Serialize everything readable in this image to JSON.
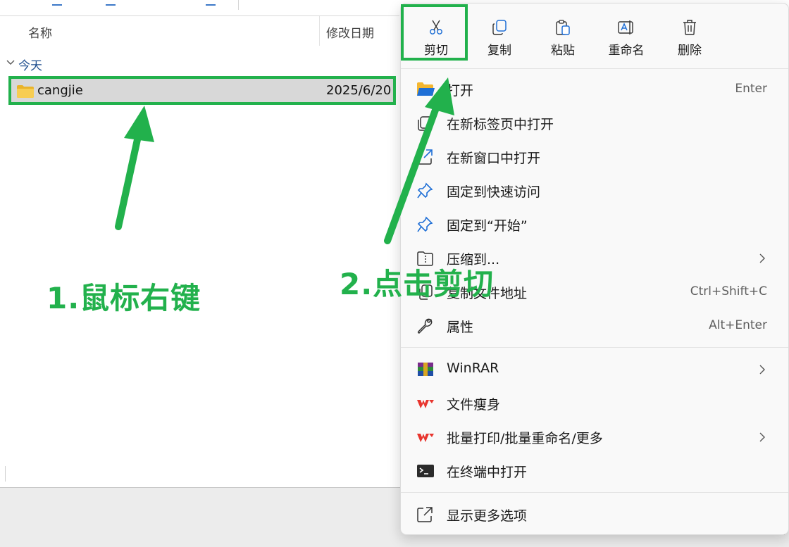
{
  "explorer": {
    "columns": {
      "name": "名称",
      "date": "修改日期"
    },
    "group_label": "今天",
    "rows": [
      {
        "name": "cangjie",
        "date": "2025/6/20"
      }
    ]
  },
  "context_menu": {
    "toolbar": [
      {
        "id": "cut",
        "label": "剪切",
        "icon": "scissors-icon"
      },
      {
        "id": "copy",
        "label": "复制",
        "icon": "copy-icon"
      },
      {
        "id": "paste",
        "label": "粘贴",
        "icon": "paste-icon"
      },
      {
        "id": "rename",
        "label": "重命名",
        "icon": "rename-icon"
      },
      {
        "id": "delete",
        "label": "删除",
        "icon": "trash-icon"
      }
    ],
    "items": [
      {
        "label": "打开",
        "shortcut": "Enter",
        "icon": "folder-open-icon"
      },
      {
        "label": "在新标签页中打开",
        "shortcut": "",
        "icon": "new-tab-icon"
      },
      {
        "label": "在新窗口中打开",
        "shortcut": "",
        "icon": "new-window-icon"
      },
      {
        "label": "固定到快速访问",
        "shortcut": "",
        "icon": "pin-icon"
      },
      {
        "label": "固定到“开始”",
        "shortcut": "",
        "icon": "pin-icon"
      },
      {
        "label": "压缩到...",
        "shortcut": "",
        "icon": "zip-folder-icon",
        "submenu": true
      },
      {
        "label": "复制文件地址",
        "shortcut": "Ctrl+Shift+C",
        "icon": "copy-path-icon"
      },
      {
        "label": "属性",
        "shortcut": "Alt+Enter",
        "icon": "wrench-icon"
      },
      {
        "label": "WinRAR",
        "shortcut": "",
        "icon": "winrar-icon",
        "submenu": true
      },
      {
        "label": "文件瘦身",
        "shortcut": "",
        "icon": "wps-icon"
      },
      {
        "label": "批量打印/批量重命名/更多",
        "shortcut": "",
        "icon": "wps-icon",
        "submenu": true
      },
      {
        "label": "在终端中打开",
        "shortcut": "",
        "icon": "terminal-icon"
      },
      {
        "label": "显示更多选项",
        "shortcut": "",
        "icon": "more-options-icon"
      }
    ]
  },
  "annotations": {
    "step1": "1.鼠标右键",
    "step2": "2.点击剪切",
    "color": "#22b14c"
  },
  "colors": {
    "accent_blue": "#1f6fd6",
    "wps_red": "#e8352e",
    "folder_yellow": "#f4c542",
    "selection": "#d8d8d8"
  }
}
